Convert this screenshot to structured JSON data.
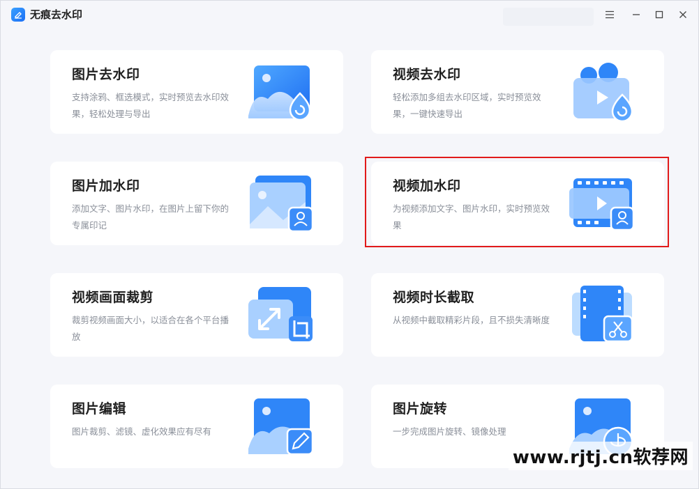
{
  "app": {
    "title": "无痕去水印"
  },
  "cards": [
    {
      "title": "图片去水印",
      "desc": "支持涂鸦、框选模式，实时预览去水印效果，轻松处理与导出"
    },
    {
      "title": "视频去水印",
      "desc": "轻松添加多组去水印区域，实时预览效果，一键快速导出"
    },
    {
      "title": "图片加水印",
      "desc": "添加文字、图片水印，在图片上留下你的专属印记"
    },
    {
      "title": "视频加水印",
      "desc": "为视频添加文字、图片水印，实时预览效果"
    },
    {
      "title": "视频画面裁剪",
      "desc": "裁剪视频画面大小，以适合在各个平台播放"
    },
    {
      "title": "视频时长截取",
      "desc": "从视频中截取精彩片段，且不损失清晰度"
    },
    {
      "title": "图片编辑",
      "desc": "图片裁剪、滤镜、虚化效果应有尽有"
    },
    {
      "title": "图片旋转",
      "desc": "一步完成图片旋转、镜像处理"
    }
  ],
  "watermark": "www.rjtj.cn软荐网",
  "colors": {
    "accent": "#2f7ff7",
    "highlight_border": "#e11a1a"
  }
}
